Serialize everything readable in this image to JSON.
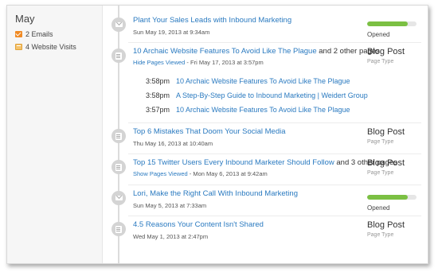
{
  "sidebar": {
    "month": "May",
    "stats": [
      {
        "icon": "email-icon",
        "label": "2 Emails"
      },
      {
        "icon": "website-visit-icon",
        "label": "4 Website Visits"
      }
    ]
  },
  "colors": {
    "link": "#2a7ac0",
    "progress": "#7bc043",
    "node": "#d4d4d4"
  },
  "timeline": [
    {
      "kind": "email",
      "title": "Plant Your Sales Leads with Inbound Marketing",
      "meta": "Sun May 19, 2013 at 9:34am",
      "status": "Opened",
      "progress": 0.82
    },
    {
      "kind": "page",
      "title": "10 Archaic Website Features To Avoid Like The Plague",
      "title_suffix": "and 2 other pages",
      "meta_link": "Hide Pages Viewed",
      "meta": "- Fri May 17, 2013 at 3:57pm",
      "type": "Blog Post",
      "type_sub": "Page Type",
      "pages": [
        {
          "time": "3:58pm",
          "title": "10 Archaic Website Features To Avoid Like The Plague"
        },
        {
          "time": "3:58pm",
          "title": "A Step-By-Step Guide to Inbound Marketing | Weidert Group"
        },
        {
          "time": "3:57pm",
          "title": "10 Archaic Website Features To Avoid Like The Plague"
        }
      ]
    },
    {
      "kind": "page",
      "title": "Top 6 Mistakes That Doom Your Social Media",
      "meta": "Thu May 16, 2013 at 10:40am",
      "type": "Blog Post",
      "type_sub": "Page Type"
    },
    {
      "kind": "page",
      "title": "Top 15 Twitter Users Every Inbound Marketer Should Follow",
      "title_suffix": "and 3 other pages",
      "meta_link": "Show Pages Viewed",
      "meta": "- Mon May 6, 2013 at 9:42am",
      "type": "Blog Post",
      "type_sub": "Page Type"
    },
    {
      "kind": "email",
      "title": "Lori, Make the Right Call With Inbound Marketing",
      "meta": "Sun May 5, 2013 at 7:33am",
      "status": "Opened",
      "progress": 0.82
    },
    {
      "kind": "page",
      "title": "4.5 Reasons Your Content Isn't Shared",
      "meta": "Wed May 1, 2013 at 2:47pm",
      "type": "Blog Post",
      "type_sub": "Page Type"
    }
  ]
}
